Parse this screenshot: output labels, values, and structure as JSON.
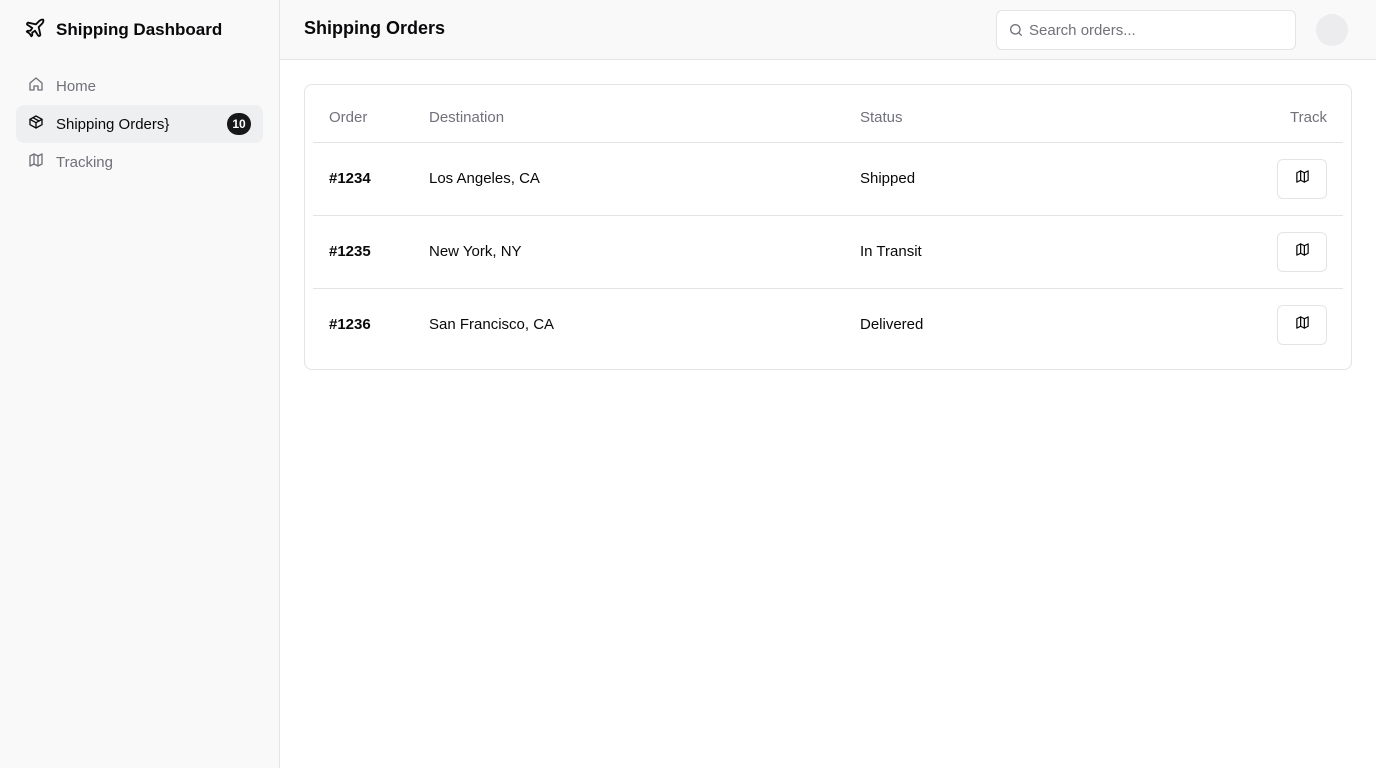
{
  "app": {
    "title": "Shipping Dashboard",
    "logo_icon": "plane-icon"
  },
  "sidebar": {
    "items": [
      {
        "label": "Home",
        "icon": "home-icon",
        "active": false
      },
      {
        "label": "Shipping Orders}",
        "icon": "package-icon",
        "active": true,
        "badge": "10"
      },
      {
        "label": "Tracking",
        "icon": "map-icon",
        "active": false
      }
    ]
  },
  "header": {
    "title": "Shipping Orders",
    "search_placeholder": "Search orders...",
    "search_value": ""
  },
  "table": {
    "columns": {
      "order": "Order",
      "destination": "Destination",
      "status": "Status",
      "track": "Track"
    },
    "rows": [
      {
        "order": "#1234",
        "destination": "Los Angeles, CA",
        "status": "Shipped",
        "track_icon": "map-icon"
      },
      {
        "order": "#1235",
        "destination": "New York, NY",
        "status": "In Transit",
        "track_icon": "map-icon"
      },
      {
        "order": "#1236",
        "destination": "San Francisco, CA",
        "status": "Delivered",
        "track_icon": "map-icon"
      }
    ]
  },
  "colors": {
    "sidebar_bg": "#f8f9f8",
    "active_bg": "#eeeff0",
    "badge_bg": "#18181b",
    "muted_text": "#71717a",
    "border": "#e4e4e7"
  }
}
